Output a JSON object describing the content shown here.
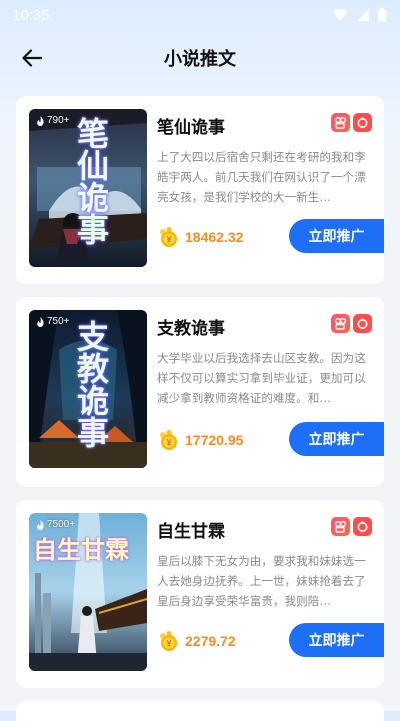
{
  "status_bar": {
    "time": "10:35"
  },
  "header": {
    "title": "小说推文"
  },
  "books": [
    {
      "title": "笔仙诡事",
      "cover_title": "笔仙诡事",
      "views": "790+",
      "description": "上了大四以后宿舍只剩还在考研的我和李皓宇两人。前几天我们在网认识了一个漂亮女孩，是我们学校的大一新生…",
      "earnings": "18462.32",
      "button_label": "立即推广"
    },
    {
      "title": "支教诡事",
      "cover_title": "支教诡事",
      "views": "750+",
      "description": "大学毕业以后我选择去山区支教。因为这样不仅可以算实习拿到毕业证，更加可以减少拿到教师资格证的难度。和…",
      "earnings": "17720.95",
      "button_label": "立即推广"
    },
    {
      "title": "自生甘霖",
      "cover_title": "自生甘霖",
      "views": "7500+",
      "description": "皇后以膝下无女为由，要求我和妹妹选一人去她身边抚养。上一世，妹妹抢着去了皇后身边享受荣华富贵，我则陪…",
      "earnings": "2279.72",
      "button_label": "立即推广"
    }
  ],
  "colors": {
    "accent": "#1d6ff5",
    "earnings": "#ff8a1a",
    "platform_a": "#ff5070",
    "platform_b": "#ff4c4c"
  },
  "icons": [
    "wifi-icon",
    "signal-icon",
    "battery-icon",
    "back-arrow-icon",
    "fire-icon",
    "kuaishou-icon",
    "douyin-icon",
    "coin-icon"
  ]
}
